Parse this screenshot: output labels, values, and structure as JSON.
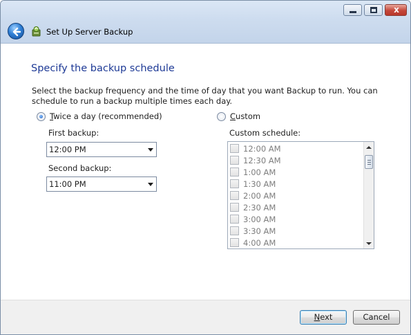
{
  "window": {
    "title": "Set Up Server Backup",
    "controls": {
      "minimize": "minimize",
      "maximize": "maximize",
      "close": "x"
    }
  },
  "page": {
    "heading": "Specify the backup schedule",
    "description": "Select the backup frequency and the time of day that you want Backup to run. You can schedule to run a backup multiple times each day."
  },
  "options": {
    "twice": {
      "accel": "T",
      "rest": "wice a day (recommended)",
      "selected": true
    },
    "custom": {
      "accel": "C",
      "rest": "ustom",
      "selected": false
    }
  },
  "first_backup": {
    "label": "First backup:",
    "value": "12:00 PM"
  },
  "second_backup": {
    "label": "Second backup:",
    "value": "11:00 PM"
  },
  "custom_schedule": {
    "label": "Custom schedule:",
    "items": [
      "12:00 AM",
      "12:30 AM",
      "1:00 AM",
      "1:30 AM",
      "2:00 AM",
      "2:30 AM",
      "3:00 AM",
      "3:30 AM",
      "4:00 AM"
    ]
  },
  "buttons": {
    "next": {
      "accel": "N",
      "rest": "ext"
    },
    "cancel": "Cancel"
  },
  "colors": {
    "heading": "#1e3a96",
    "titlebar": "#cddcef",
    "footer": "#f0f0f0",
    "disabled_text": "#7d7d7d"
  },
  "icons": {
    "back": "back-arrow-icon",
    "app": "server-backup-icon"
  }
}
